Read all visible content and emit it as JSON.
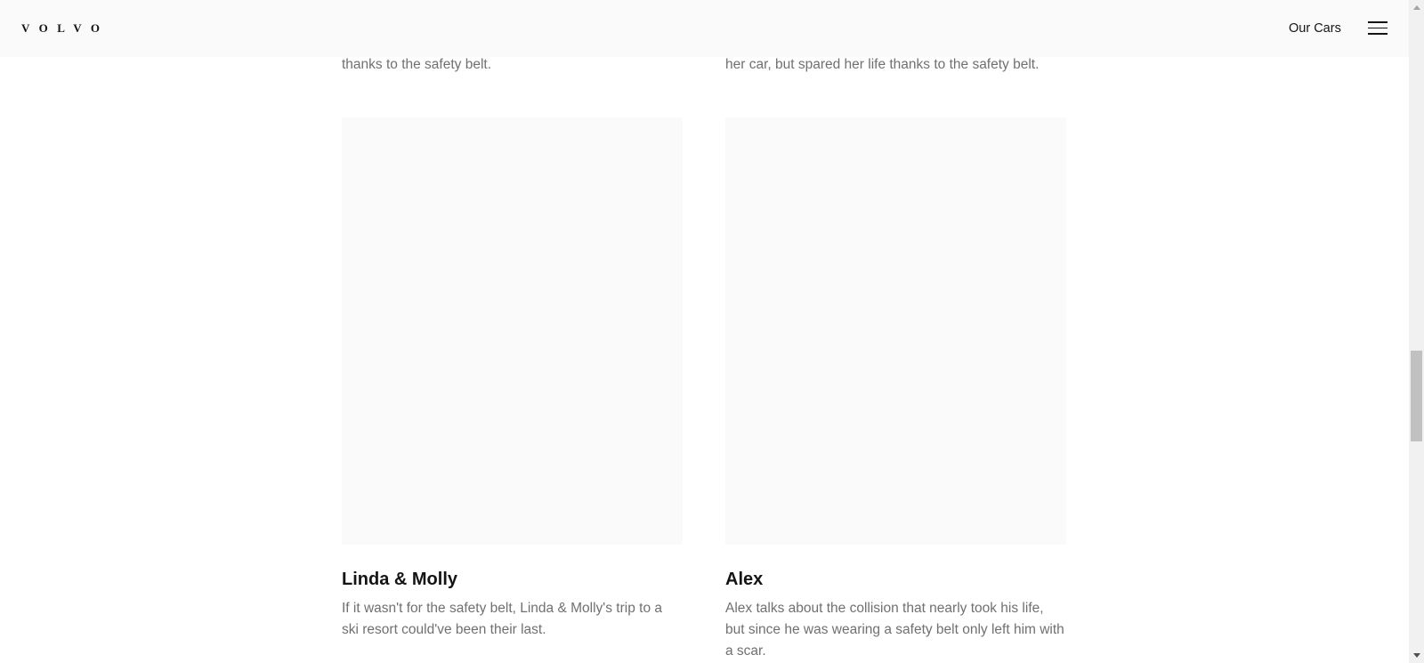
{
  "header": {
    "logo_text": "VOLVO",
    "nav_our_cars": "Our Cars",
    "menu_icon": "hamburger-menu-icon"
  },
  "stories_prev": {
    "left_tail": "thanks to the safety belt.",
    "right_tail": "her car, but spared her life thanks to the safety belt."
  },
  "stories": [
    {
      "title": "Linda & Molly",
      "description": "If it wasn't for the safety belt, Linda & Molly's trip to a ski resort could've been their last."
    },
    {
      "title": "Alex",
      "description": "Alex talks about the collision that nearly took his life, but since he was wearing a safety belt only left him with a scar."
    }
  ],
  "colors": {
    "header_bg": "#fafafa",
    "text_primary": "#141414",
    "text_secondary": "#707070",
    "image_placeholder": "#fafafa"
  }
}
